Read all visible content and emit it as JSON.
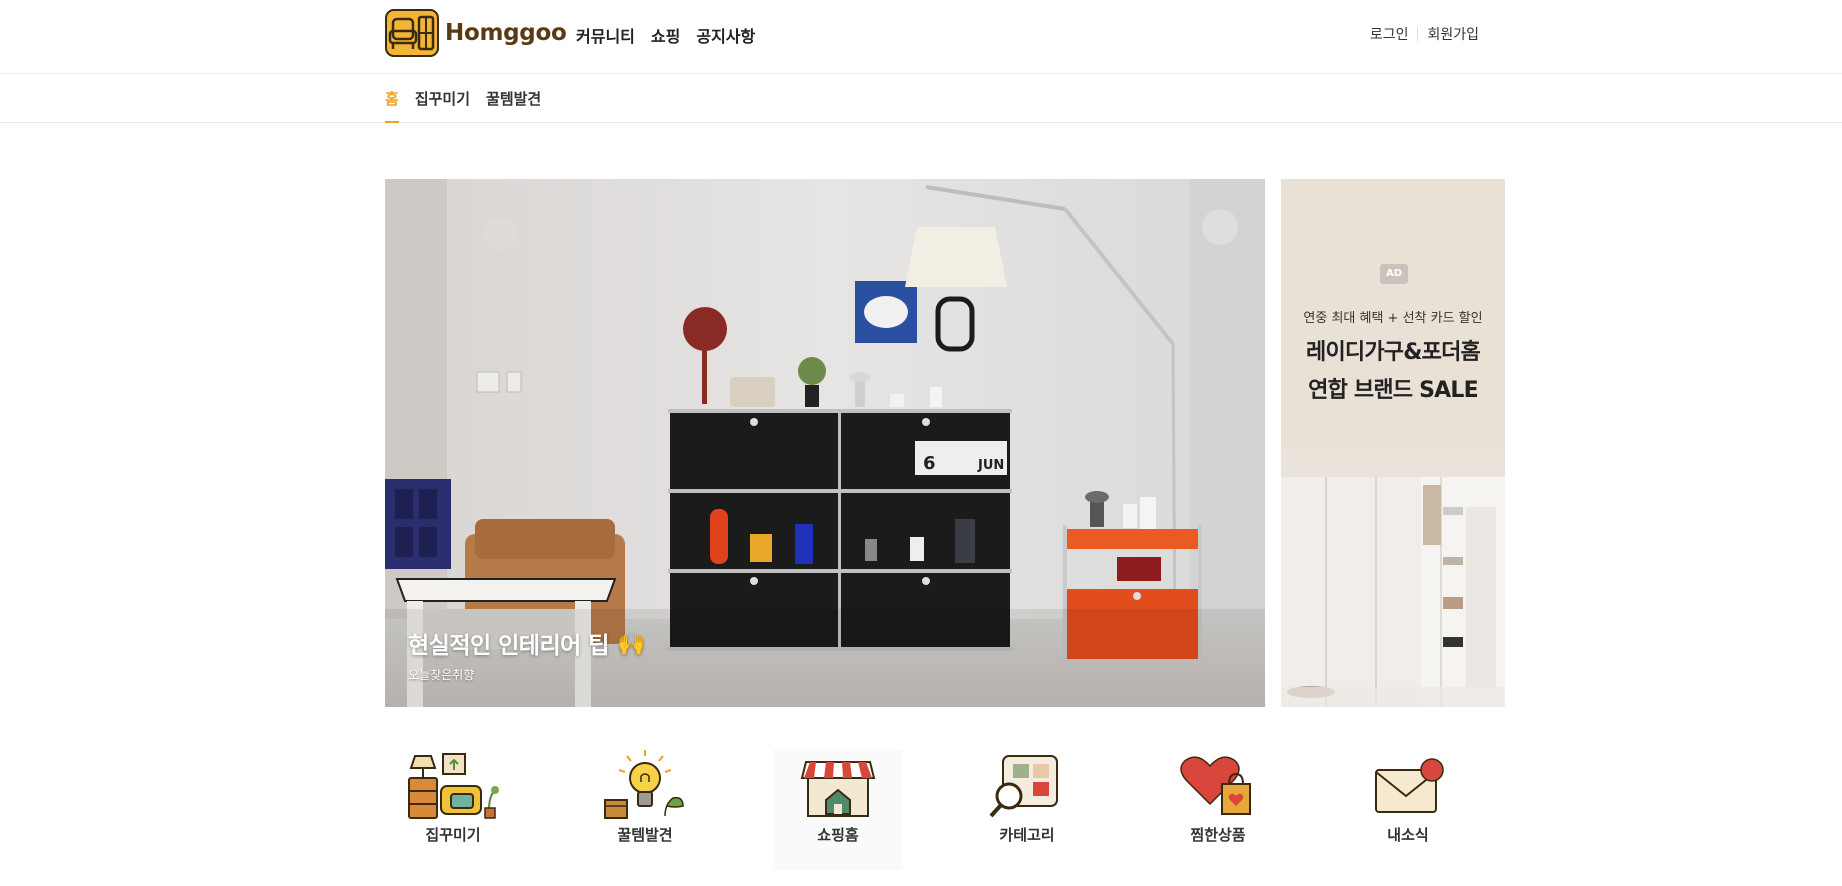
{
  "brand": {
    "name": "Homggoo"
  },
  "main_nav": [
    "커뮤니티",
    "쇼핑",
    "공지사항"
  ],
  "auth": {
    "login": "로그인",
    "signup": "회원가입"
  },
  "sub_nav": {
    "items": [
      "홈",
      "집꾸미기",
      "꿀템발견"
    ],
    "active": "홈"
  },
  "hero": {
    "title": "현실적인 인테리어 팁",
    "emoji": "🙌",
    "subtitle": "오늘찾은취향"
  },
  "ad": {
    "badge": "AD",
    "line1": "연중 최대 혜택 + 선착 카드 할인",
    "line2a": "레이디가구&포더홈",
    "line2b": "연합 브랜드 SALE"
  },
  "categories": [
    {
      "label": "집꾸미기",
      "icon": "furniture-icon"
    },
    {
      "label": "꿀템발견",
      "icon": "lightbulb-icon"
    },
    {
      "label": "쇼핑홈",
      "icon": "store-icon"
    },
    {
      "label": "카테고리",
      "icon": "category-search-icon"
    },
    {
      "label": "찜한상품",
      "icon": "heart-bag-icon"
    },
    {
      "label": "내소식",
      "icon": "mail-notification-icon"
    }
  ],
  "colors": {
    "accent": "#f0a21c",
    "brand": "#5a3a12",
    "logo_bg": "#f2b535"
  }
}
